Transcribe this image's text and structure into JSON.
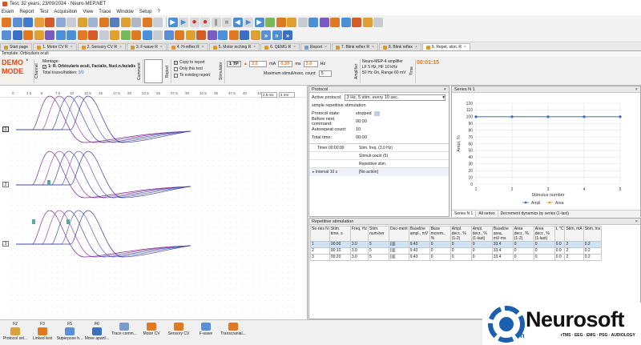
{
  "window": {
    "title": "Test, 32 years, 23/09/2024 - Neuro-MEP.NET"
  },
  "menu": [
    "Exam",
    "Report",
    "Test",
    "Acquisition",
    "View",
    "Trace",
    "Window",
    "Setup",
    "?"
  ],
  "tabs": [
    {
      "label": "Start page",
      "closable": false
    },
    {
      "label": "1. Motor CV R",
      "closable": true
    },
    {
      "label": "2. Sensory CV R",
      "closable": true
    },
    {
      "label": "3. F-wave R",
      "closable": true
    },
    {
      "label": "4. H-reflex R",
      "closable": true
    },
    {
      "label": "5. Motor inching R",
      "closable": true
    },
    {
      "label": "6. QEMG R",
      "closable": true
    },
    {
      "label": "Report",
      "closable": true
    },
    {
      "label": "7. Blink reflex R",
      "closable": true
    },
    {
      "label": "8. Blink reflex",
      "closable": true
    },
    {
      "label": "9. Repet. stim. R",
      "closable": true,
      "active": true
    }
  ],
  "template": {
    "text": "Template: Orbicularis oculi"
  },
  "demo": {
    "line1": "DEMO",
    "line2": "MODE"
  },
  "channel": {
    "label": "Channel",
    "montage_label": "Montage:",
    "montage_value": "1: R. Orbicularis oculi, Facialis, Nucl.n.facialis",
    "traces_label": "Total traces/hidden:",
    "traces_value": "3/0"
  },
  "comment": {
    "label": "Comment"
  },
  "report": {
    "label": "Report",
    "copy_to_report": "Copy to report",
    "only_this_test": "Only this test",
    "to_existing_report": "To existing report",
    "copy_checked": true,
    "only_checked": false,
    "existing_checked": false
  },
  "stimulator": {
    "label": "Stimulator",
    "mode": "1 TP",
    "current": "2.0",
    "current_unit": "mA",
    "duration": "0.20",
    "duration_unit": "ms",
    "freq": "3.0",
    "freq_unit": "Hz",
    "max_label": "Maximum stimuli/exec. count:",
    "max_value": "5"
  },
  "amplifier": {
    "label": "Amplifier",
    "line1": "Neuro-MEP-4 amplifier",
    "line2": "LF 5 Hz, HF  10 kHz",
    "line3": "50 Hz  On, Range 60 mV"
  },
  "time": {
    "label": "Time",
    "value": "00:01:15"
  },
  "trace_controls": {
    "speed": "2.5 ms",
    "gain": "4 mV"
  },
  "channels": [
    {
      "id": "1",
      "selected": true
    },
    {
      "id": "2",
      "selected": false
    },
    {
      "id": "3",
      "selected": false
    }
  ],
  "protocol": {
    "title": "Protocol",
    "active_label": "Active protocol:",
    "active_value": "3 Hz, 5 stim. every 10 sec.",
    "name": "simple repetitive stimulation",
    "state_label": "Protocol state:",
    "state_value": "stopped",
    "before_label": "Before next command:",
    "before_value": "00:00",
    "autorepeat_label": "Autorepeat count:",
    "autorepeat_value": "10",
    "total_label": "Total time:",
    "total_value": "00:00",
    "steps": [
      {
        "left": "Timer 00:00:00",
        "right": "Stim. freq. (3.0 Hz)"
      },
      {
        "left": "",
        "right": "Stimuli count (5)"
      },
      {
        "left": "",
        "right": "Repetitive stim."
      },
      {
        "left": "Interval 10 s",
        "right": "[No action]"
      }
    ]
  },
  "series_panel": {
    "title": "Series N 1",
    "tabs": [
      "Series N 1",
      "All series",
      "Decrement dynamics by series (1-last)"
    ]
  },
  "chart_data": {
    "type": "line",
    "title": "",
    "xlabel": "Stimulus number",
    "ylabel": "Ampl, %",
    "x": [
      1,
      2,
      3,
      4,
      5
    ],
    "xticks": [
      1,
      2,
      3,
      4,
      5
    ],
    "yticks": [
      0,
      10,
      20,
      30,
      40,
      50,
      60,
      70,
      80,
      90,
      100,
      110,
      120
    ],
    "ylim": [
      0,
      120
    ],
    "xlim": [
      1,
      5
    ],
    "grid": true,
    "series": [
      {
        "name": "Ampl",
        "values": [
          100,
          100,
          100,
          100,
          100
        ],
        "color": "#3a6fc4"
      },
      {
        "name": "Area",
        "values": [
          100,
          100,
          100,
          100,
          100
        ],
        "color": "#e0a020"
      }
    ],
    "legend": "bottom"
  },
  "rep_table": {
    "title": "Repetitive stimulation",
    "headers": [
      "Se-ries N",
      "Stim. time, s",
      "Freq, Hz",
      "Stim. num-ber",
      "Dec-ment",
      "Baseline ampl., mV",
      "Base mcrem., %",
      "Ampl. decr., % (1-2)",
      "Ampl. decr., % (1-last)",
      "Baseline area, mV·ms",
      "Area decr., % (1-2)",
      "Area decr., % (1-last)",
      "t, °C",
      "Stim, mA",
      "Stim, ms"
    ],
    "rows": [
      [
        "1",
        "00:00",
        "3.0",
        "5",
        "|||||",
        "9.43",
        "0",
        "0",
        "0",
        "33.4",
        "0",
        "0",
        "0.0",
        "2",
        "0.2"
      ],
      [
        "2",
        "00:10",
        "3.0",
        "5",
        "|||||",
        "9.43",
        "0",
        "0",
        "0",
        "33.4",
        "0",
        "0",
        "0.0",
        "2",
        "0.2"
      ],
      [
        "3",
        "00:20",
        "3.0",
        "5",
        "|||||",
        "9.43",
        "0",
        "0",
        "0",
        "33.4",
        "0",
        "0",
        "0.0",
        "2",
        "0.2"
      ]
    ]
  },
  "fkeys": [
    {
      "key": "F2",
      "label": "Protocol sel..."
    },
    {
      "key": "F3",
      "label": "Linked test"
    },
    {
      "key": "F5",
      "label": "Superpose h..."
    },
    {
      "key": "F6",
      "label": "Move apart/..."
    },
    {
      "key": "",
      "label": "Trace comm..."
    },
    {
      "key": "",
      "label": "Motor CV"
    },
    {
      "key": "",
      "label": "Sensory CV"
    },
    {
      "key": "",
      "label": "F-wave"
    },
    {
      "key": "",
      "label": "Transcranial..."
    }
  ],
  "logo": {
    "brand": "Neurosoft",
    "sub": "vn",
    "tagline": "rTMS · EEG · EMG · PSG · AUDIOLOGY"
  }
}
